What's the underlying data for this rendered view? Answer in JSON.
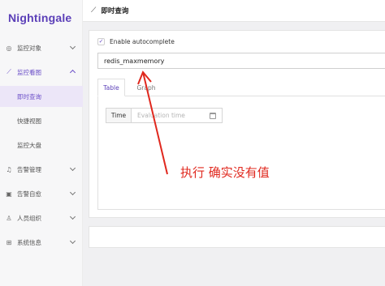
{
  "sidebar": {
    "logo": "Nightingale",
    "items": [
      {
        "label": "监控对象",
        "icon": "target-icon"
      },
      {
        "label": "监控看图",
        "icon": "chart-line-icon"
      },
      {
        "label": "即时查询"
      },
      {
        "label": "快捷视图"
      },
      {
        "label": "监控大盘"
      },
      {
        "label": "告警管理",
        "icon": "bell-icon"
      },
      {
        "label": "告警自愈",
        "icon": "terminal-icon"
      },
      {
        "label": "人员组织",
        "icon": "user-icon"
      },
      {
        "label": "系统信息",
        "icon": "grid-icon"
      }
    ]
  },
  "header": {
    "title": "即时查询",
    "icon": "chart-line-icon"
  },
  "query": {
    "autocomplete_label": "Enable autocomplete",
    "autocomplete_checked": true,
    "expression": "redis_maxmemory",
    "tabs": [
      {
        "label": "Table",
        "active": true
      },
      {
        "label": "Graph",
        "active": false
      }
    ],
    "time_label": "Time",
    "time_placeholder": "Evaluation time"
  },
  "annotation": {
    "text": "执行 确实没有值",
    "color": "#e0281e"
  },
  "colors": {
    "accent": "#6b4fc8",
    "logo": "#5b3fb8",
    "annotation": "#e0281e"
  }
}
